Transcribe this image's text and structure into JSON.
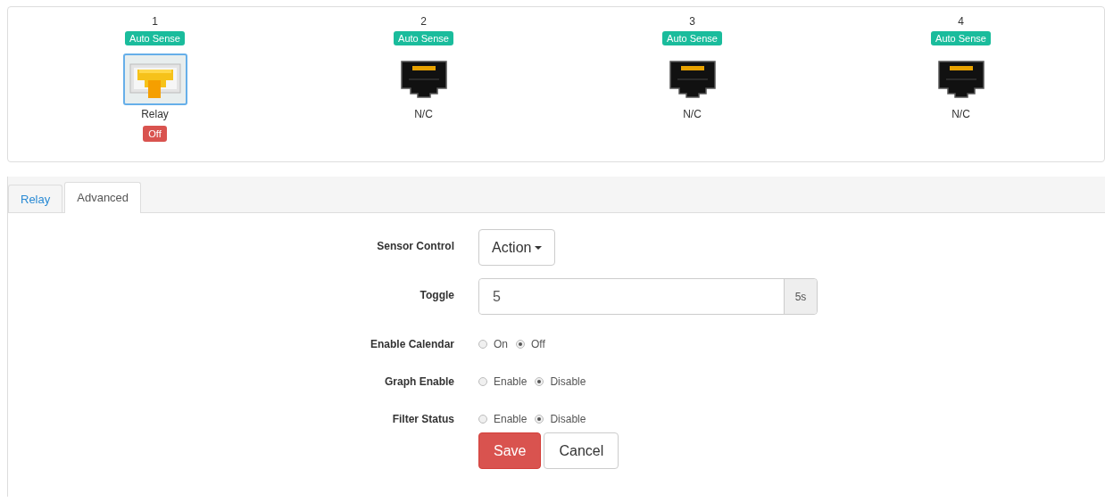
{
  "ports": [
    {
      "number": "1",
      "badge": "Auto Sense",
      "kind": "relay",
      "selected": true,
      "label": "Relay",
      "status": "Off"
    },
    {
      "number": "2",
      "badge": "Auto Sense",
      "kind": "empty",
      "selected": false,
      "label": "N/C"
    },
    {
      "number": "3",
      "badge": "Auto Sense",
      "kind": "empty",
      "selected": false,
      "label": "N/C"
    },
    {
      "number": "4",
      "badge": "Auto Sense",
      "kind": "empty",
      "selected": false,
      "label": "N/C"
    }
  ],
  "tabs": [
    {
      "label": "Relay",
      "selected": false
    },
    {
      "label": "Advanced",
      "selected": true
    }
  ],
  "form": {
    "rows": [
      {
        "kind": "dropdown",
        "label": "Sensor Control",
        "value": "Action"
      },
      {
        "kind": "input",
        "label": "Toggle",
        "value": "5",
        "addon": "5s"
      },
      {
        "kind": "radio",
        "label": "Enable Calendar",
        "options": [
          {
            "label": "On",
            "selected": false
          },
          {
            "label": "Off",
            "selected": true
          }
        ]
      },
      {
        "kind": "radio",
        "label": "Graph Enable",
        "options": [
          {
            "label": "Enable",
            "selected": false
          },
          {
            "label": "Disable",
            "selected": true
          }
        ]
      },
      {
        "kind": "radio",
        "label": "Filter Status",
        "options": [
          {
            "label": "Enable",
            "selected": false
          },
          {
            "label": "Disable",
            "selected": true
          }
        ]
      }
    ]
  },
  "buttons": [
    {
      "label": "Save",
      "kind": "primary"
    },
    {
      "label": "Cancel",
      "kind": "default"
    }
  ]
}
